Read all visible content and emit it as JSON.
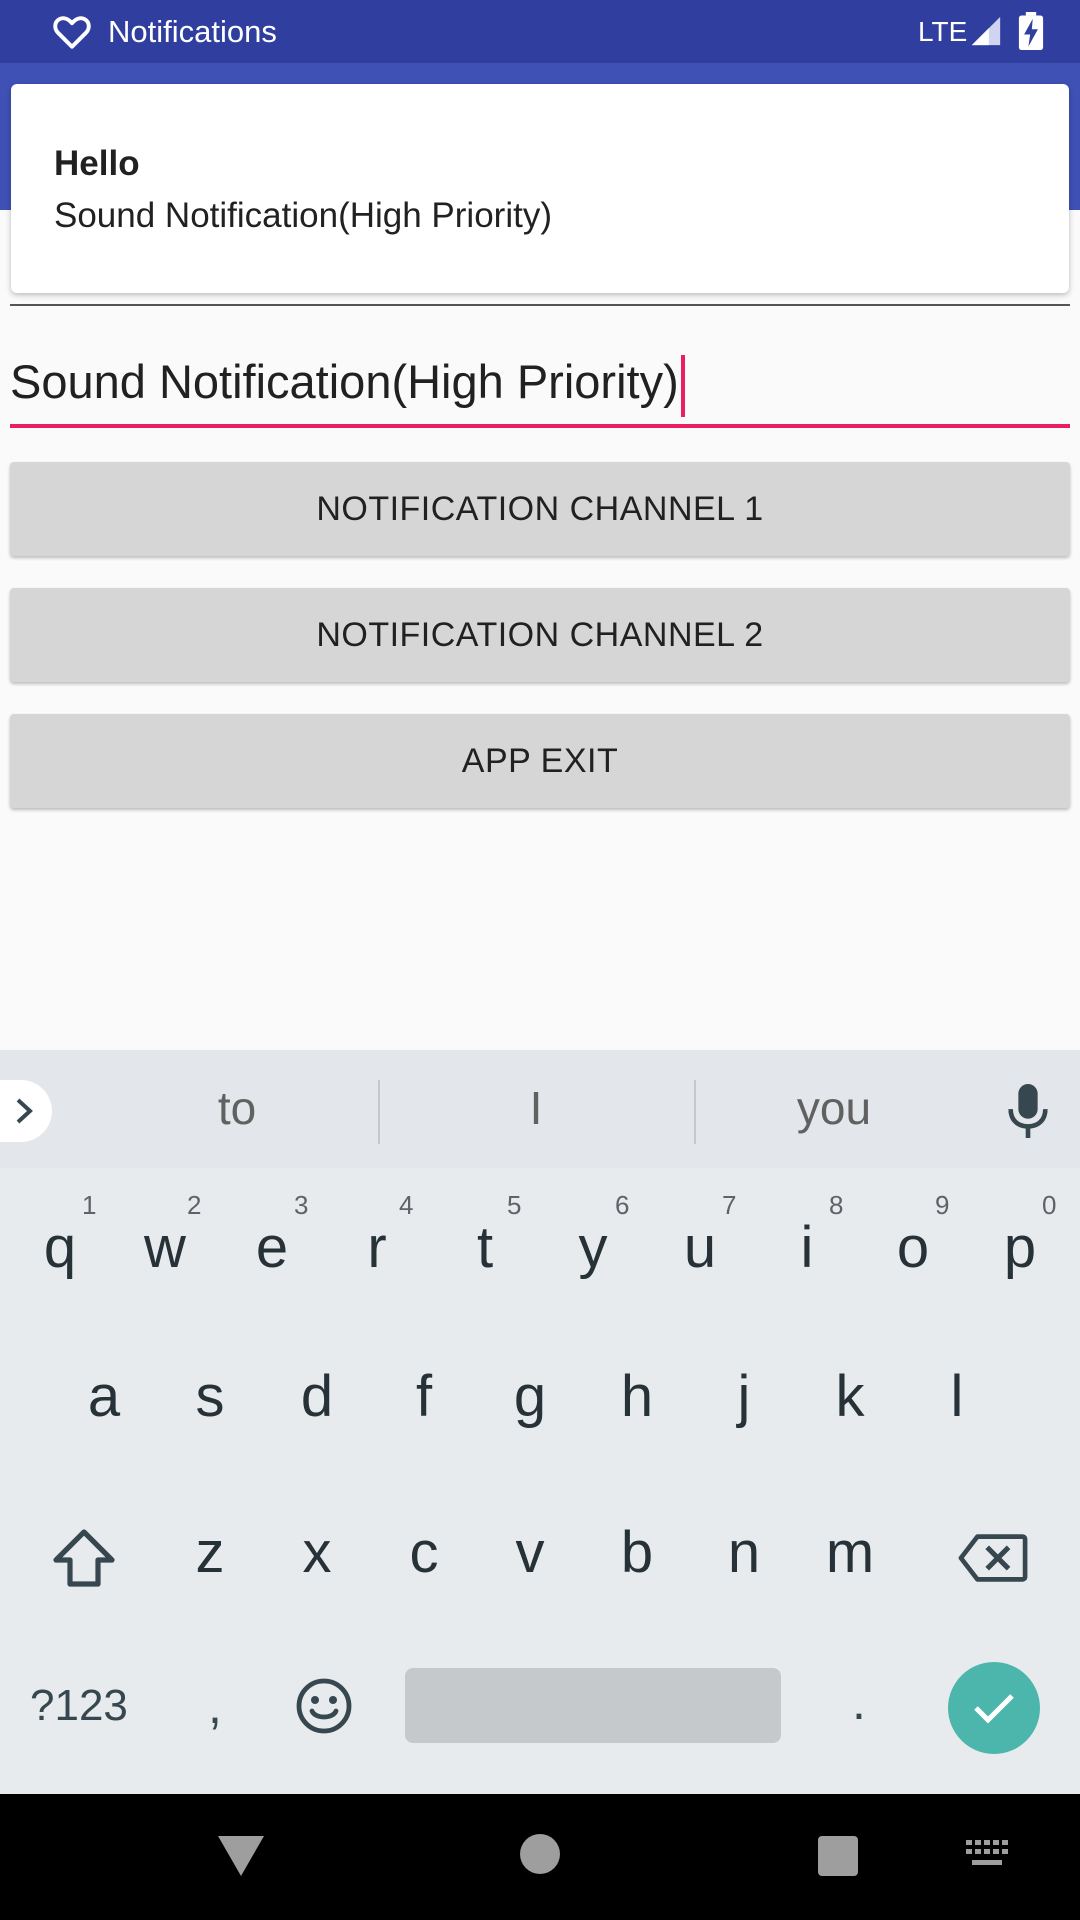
{
  "status_bar": {
    "app_icon": "heart-outline-icon",
    "title": "Notifications",
    "network": "LTE",
    "signal_icon": "cell-signal-icon",
    "battery_icon": "battery-charging-icon"
  },
  "notification": {
    "title": "Hello",
    "text": "Sound Notification(High Priority)"
  },
  "input": {
    "value": "Sound Notification(High Priority)"
  },
  "buttons": {
    "channel1": "NOTIFICATION CHANNEL 1",
    "channel2": "NOTIFICATION CHANNEL 2",
    "exit": "APP EXIT"
  },
  "keyboard": {
    "suggestions": [
      "to",
      "I",
      "you"
    ],
    "row1": [
      "q",
      "w",
      "e",
      "r",
      "t",
      "y",
      "u",
      "i",
      "o",
      "p"
    ],
    "row1_hints": [
      "1",
      "2",
      "3",
      "4",
      "5",
      "6",
      "7",
      "8",
      "9",
      "0"
    ],
    "row2": [
      "a",
      "s",
      "d",
      "f",
      "g",
      "h",
      "j",
      "k",
      "l"
    ],
    "row3": [
      "z",
      "x",
      "c",
      "v",
      "b",
      "n",
      "m"
    ],
    "symbols_label": "?123",
    "comma": ",",
    "period": "."
  },
  "colors": {
    "status_bar": "#303f9f",
    "app_bar": "#3f51b5",
    "accent": "#e91e63",
    "enter_key": "#4db6ac"
  }
}
